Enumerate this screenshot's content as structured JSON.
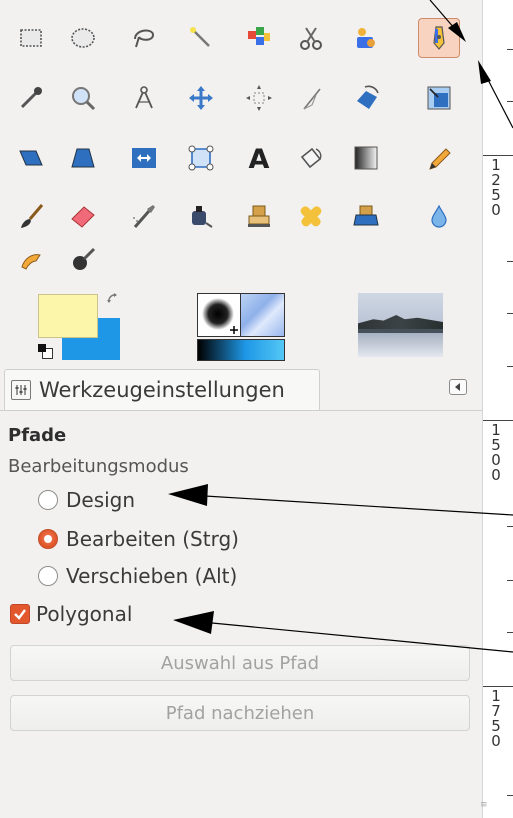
{
  "toolbox": {
    "tools": [
      {
        "name": "rect-select-icon"
      },
      {
        "name": "ellipse-select-icon"
      },
      {
        "name": "free-select-icon"
      },
      {
        "name": "fuzzy-select-icon"
      },
      {
        "name": "select-by-color-icon"
      },
      {
        "name": "scissors-select-icon"
      },
      {
        "name": "foreground-select-icon"
      },
      {
        "name": "paths-tool-icon",
        "active": true
      },
      {
        "name": "color-picker-icon"
      },
      {
        "name": "zoom-icon"
      },
      {
        "name": "measure-icon"
      },
      {
        "name": "move-icon"
      },
      {
        "name": "align-icon"
      },
      {
        "name": "crop-icon"
      },
      {
        "name": "rotate-icon"
      },
      {
        "name": "scale-icon"
      },
      {
        "name": "shear-icon"
      },
      {
        "name": "perspective-icon"
      },
      {
        "name": "flip-icon"
      },
      {
        "name": "cage-icon"
      },
      {
        "name": "text-icon",
        "glyph": "A"
      },
      {
        "name": "bucket-fill-icon"
      },
      {
        "name": "blend-icon"
      },
      {
        "name": "pencil-icon"
      },
      {
        "name": "paintbrush-icon"
      },
      {
        "name": "eraser-icon"
      },
      {
        "name": "airbrush-icon"
      },
      {
        "name": "ink-icon"
      },
      {
        "name": "clone-icon"
      },
      {
        "name": "heal-icon"
      },
      {
        "name": "perspective-clone-icon"
      },
      {
        "name": "blur-icon"
      },
      {
        "name": "smudge-icon"
      },
      {
        "name": "dodge-burn-icon"
      }
    ],
    "colors": {
      "foreground": "#fbf6a9",
      "background": "#1e97e6",
      "accent": "#e2572c"
    }
  },
  "tool_options": {
    "tab_icon": "tool-options-icon",
    "tab_label": "Werkzeugeinstellungen",
    "title": "Pfade",
    "mode_label": "Bearbeitungsmodus",
    "modes": [
      {
        "label": "Design",
        "selected": false
      },
      {
        "label": "Bearbeiten (Strg)",
        "selected": true
      },
      {
        "label": "Verschieben (Alt)",
        "selected": false
      }
    ],
    "polygonal_label": "Polygonal",
    "polygonal_checked": true,
    "button_selection_from_path": "Auswahl aus Pfad",
    "button_stroke_path": "Pfad nachziehen"
  },
  "ruler": {
    "labels": [
      "1250",
      "1500",
      "1750"
    ]
  }
}
